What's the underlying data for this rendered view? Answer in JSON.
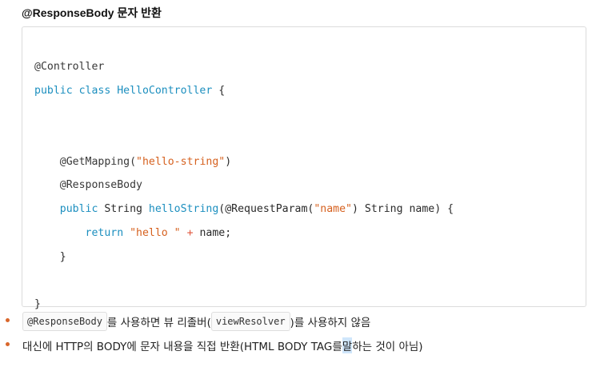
{
  "heading": "@ResponseBody 문자 반환",
  "code_lines": [
    [
      {
        "t": "@Controller",
        "c": "tok-ann"
      }
    ],
    [
      {
        "t": "public class ",
        "c": "tok-kw"
      },
      {
        "t": "HelloController",
        "c": "tok-func"
      },
      {
        "t": " {",
        "c": "tok-plain"
      }
    ],
    [],
    [],
    [
      {
        "t": "    @GetMapping(",
        "c": "tok-ann"
      },
      {
        "t": "\"hello-string\"",
        "c": "tok-str"
      },
      {
        "t": ")",
        "c": "tok-plain"
      }
    ],
    [
      {
        "t": "    @ResponseBody",
        "c": "tok-ann"
      }
    ],
    [
      {
        "t": "    public ",
        "c": "tok-kw"
      },
      {
        "t": "String ",
        "c": "tok-plain"
      },
      {
        "t": "helloString",
        "c": "tok-func"
      },
      {
        "t": "(@RequestParam(",
        "c": "tok-plain"
      },
      {
        "t": "\"name\"",
        "c": "tok-str"
      },
      {
        "t": ") String name) {",
        "c": "tok-plain"
      }
    ],
    [
      {
        "t": "        return ",
        "c": "tok-kw"
      },
      {
        "t": "\"hello \"",
        "c": "tok-str"
      },
      {
        "t": " + ",
        "c": "tok-op"
      },
      {
        "t": "name;",
        "c": "tok-plain"
      }
    ],
    [
      {
        "t": "    }",
        "c": "tok-plain"
      }
    ],
    [],
    [
      {
        "t": "}",
        "c": "tok-plain"
      }
    ]
  ],
  "bullets": {
    "first": {
      "code1": "@ResponseBody",
      "text1": "를 사용하면 뷰 리졸버(",
      "code2": "viewResolver",
      "text2": ")를 사용하지 않음"
    },
    "second": {
      "before": "대신에 HTTP의 BODY에 문자 내용을 직접 반환(HTML BODY TAG를 ",
      "highlight": "말",
      "after": "하는 것이 아님)"
    }
  },
  "colors": {
    "keyword": "#1c8fbf",
    "string": "#d6611f",
    "bullet": "#d9662b"
  }
}
